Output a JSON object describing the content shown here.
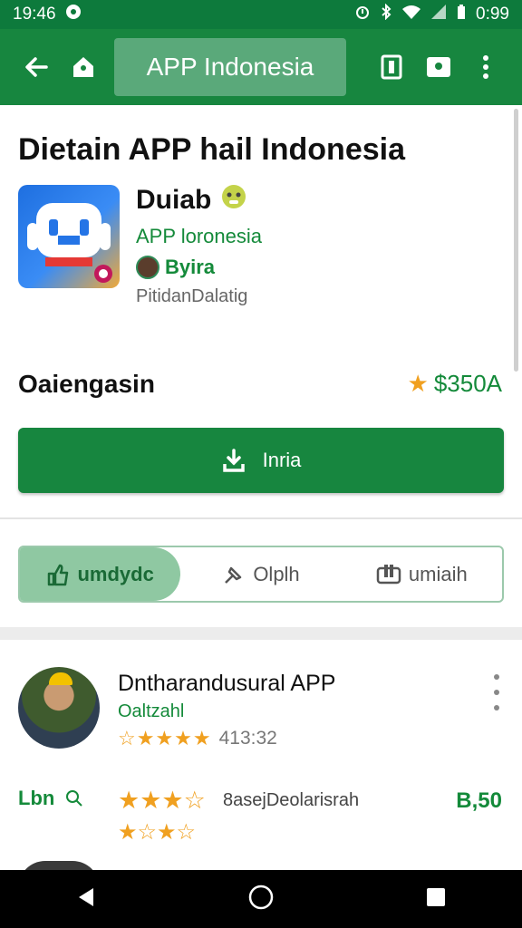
{
  "status_bar": {
    "time": "19:46",
    "battery": "0:99"
  },
  "app_bar": {
    "title": "APP Indonesia"
  },
  "header": {
    "headline": "Dietain APP hail Indonesia"
  },
  "app": {
    "name": "Duiab",
    "developer": "APP loronesia",
    "owner": "Byira",
    "subtitle": "PitidanDalatig"
  },
  "info": {
    "label": "Oaiengasin",
    "price": "$350A"
  },
  "install_button": {
    "label": "Inria"
  },
  "tabs": [
    {
      "label": "umdydc",
      "active": true
    },
    {
      "label": "Olplh",
      "active": false
    },
    {
      "label": "umiaih",
      "active": false
    }
  ],
  "review": {
    "title": "Dntharandusural APP",
    "subtitle": "Oaltzahl",
    "stars_text": "☆★★★★",
    "rating_count": "413:32"
  },
  "rating_row": {
    "label": "Lbn",
    "stars_line1": "★★★☆",
    "stars_line2": "★☆★☆",
    "text": "8asejDeolarisrah",
    "value": "B,50"
  },
  "colors": {
    "primary": "#17863f",
    "status": "#0d7a3c",
    "accent_green": "#148a3a",
    "star": "#f0a020"
  }
}
